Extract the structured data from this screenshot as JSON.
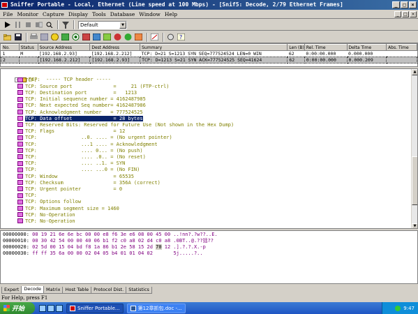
{
  "window": {
    "title": "Sniffer Portable - Local, Ethernet (Line speed at 100 Mbps) - [Snif5: Decode, 2/79 Ethernet Frames]",
    "controls": [
      "_",
      "□",
      "×"
    ],
    "mdi_controls": [
      "_",
      "□",
      "×"
    ]
  },
  "menu": [
    "File",
    "Monitor",
    "Capture",
    "Display",
    "Tools",
    "Database",
    "Window",
    "Help"
  ],
  "toolbar": {
    "profile_select": "Default"
  },
  "packet_list": {
    "columns": [
      "No.",
      "Status",
      "Source Address",
      "Dest Address",
      "Summary",
      "Len (B)",
      "Rel. Time",
      "Delta Time",
      "Abs. Time"
    ],
    "rows": [
      [
        "1",
        "M",
        "[192.168.2.93]",
        "[192.168.2.212]",
        "TCP: D=21 S=1213 SYN SEQ=777524524 LEN=0 WIN",
        "62",
        "0:00:00.000",
        "0.000.000",
        ""
      ],
      [
        "2",
        "",
        "[192.168.2.212]",
        "[192.168.2.93]",
        "TCP: D=1213 S=21 SYN ACK=777524525 SEQ=41624",
        "62",
        "0:00:00.000",
        "0.000.209",
        ""
      ]
    ]
  },
  "decode": {
    "header": "TCP:  ----- TCP header -----",
    "lines": [
      "TCP:",
      "TCP: Source port              =     21 (FTP-ctrl)",
      "TCP: Destination port         =   1213",
      "TCP: Initial sequence number = 4162487985",
      "TCP: Next expected Seq number= 4162487986",
      "TCP: Acknowledgment number   = 777524525",
      "TCP: Data offset              = 28 bytes",
      "TCP: Reserved Bits: Reserved for Future Use (Not shown in the Hex Dump)",
      "TCP: Flags                    = 12",
      "TCP:               ..0. .... = (No urgent pointer)",
      "TCP:               ...1 .... = Acknowledgment",
      "TCP:               .... 0... = (No push)",
      "TCP:               .... .0.. = (No reset)",
      "TCP:               .... ..1. = SYN",
      "TCP:               .... ...0 = (No FIN)",
      "TCP: Window                   = 65535",
      "TCP: Checksum                 = 356A (correct)",
      "TCP: Urgent pointer           = 0",
      "TCP:",
      "TCP: Options follow",
      "TCP: Maximum segment size = 1460",
      "TCP: No-Operation",
      "TCP: No-Operation"
    ],
    "highlighted_index": 6
  },
  "hex": [
    {
      "addr": "00000000:",
      "bytes": " 00 19 21 6e 6e bc 00 00 e8 f6 3e e6 08 00 45 00 ",
      "ascii": "..!nn?.?w??..E."
    },
    {
      "addr": "00000010:",
      "bytes": " 00 30 42 54 00 00 40 06 b1 f2 c0 a8 02 d4 c0 a8 ",
      "ascii": ".0BT..@.??括??"
    },
    {
      "addr": "00000020:",
      "bytes": " 02 5d 00 15 04 bd f8 1a 86 b1 2e 58 15 2d ",
      "hi": "70",
      "rest": " 12 ",
      "ascii": ".].?.?.X.-p"
    },
    {
      "addr": "00000030:",
      "bytes": " ff ff 35 6a 00 00 02 04 05 b4 01 01 04 02       ",
      "ascii": "5j.....?.."
    }
  ],
  "tabs": [
    "Expert",
    "Decode",
    "Matrix",
    "Host Table",
    "Protocol Dist.",
    "Statistics"
  ],
  "active_tab": "Decode",
  "status_text": "For Help, press F1",
  "taskbar": {
    "start_label": "开始",
    "tasks": [
      "Sniffer Portable...",
      "第12章抓包.doc -..."
    ],
    "clock": "9:47"
  }
}
